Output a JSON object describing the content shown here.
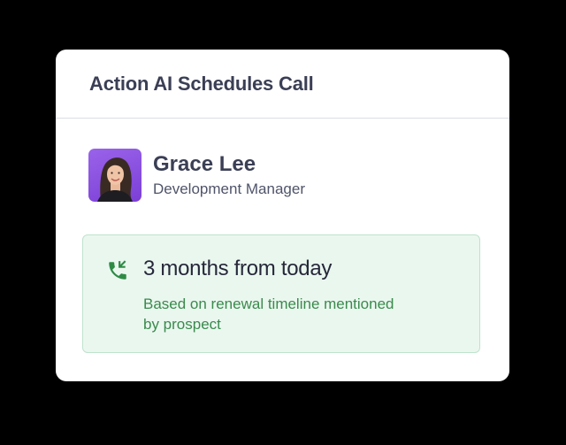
{
  "card": {
    "title": "Action AI Schedules Call"
  },
  "contact": {
    "name": "Grace Lee",
    "role": "Development Manager",
    "avatar_bg": "#8b4fe0"
  },
  "call": {
    "icon": "phone-callback-icon",
    "time": "3 months from today",
    "note": "Based on renewal timeline mentioned by prospect",
    "accent_color": "#2e8b45",
    "box_bg": "#eaf7ef"
  }
}
